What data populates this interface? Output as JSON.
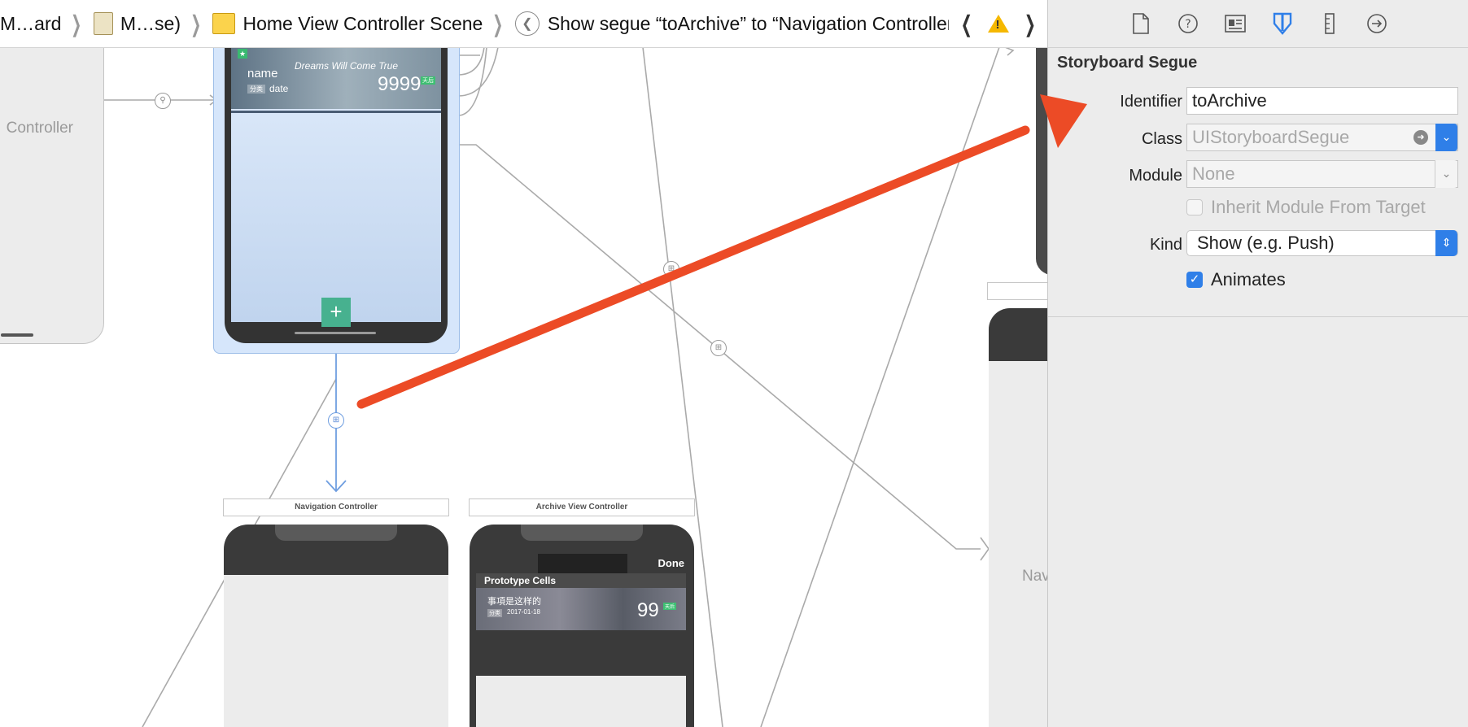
{
  "breadcrumb": {
    "items": [
      "M…ard",
      "M…se)",
      "Home View Controller Scene",
      "Show segue “toArchive” to “Navigation Controller”"
    ]
  },
  "canvas": {
    "left_controller_label": "Controller",
    "home_cell": {
      "name": "name",
      "tag": "分类",
      "date": "date",
      "motto": "Dreams Will Come True",
      "number": "9999",
      "badge": "天后"
    },
    "add_button": "+",
    "nav_controller_title": "Navigation Controller",
    "archive_controller_title": "Archive View Controller",
    "archive": {
      "done": "Done",
      "prototype_cells": "Prototype Cells",
      "cell_title": "事項是这样的",
      "cell_tag": "分类",
      "cell_date": "2017-01-18",
      "cell_number": "99",
      "cell_badge": "天后"
    },
    "right_nav_label": "Nav"
  },
  "inspector": {
    "tabs": [
      "file-icon",
      "help-icon",
      "identity-icon",
      "attributes-icon",
      "size-icon",
      "connections-icon"
    ],
    "active_tab": "attributes-icon",
    "section_title": "Storyboard Segue",
    "identifier_label": "Identifier",
    "identifier_value": "toArchive",
    "class_label": "Class",
    "class_placeholder": "UIStoryboardSegue",
    "module_label": "Module",
    "module_placeholder": "None",
    "inherit_label": "Inherit Module From Target",
    "inherit_checked": false,
    "kind_label": "Kind",
    "kind_value": "Show (e.g. Push)",
    "animates_label": "Animates",
    "animates_checked": true
  },
  "colors": {
    "accent": "#2f7fe8",
    "annotation_arrow": "#ec4b26",
    "selection": "#d6e6fb",
    "warning": "#f5b800"
  }
}
